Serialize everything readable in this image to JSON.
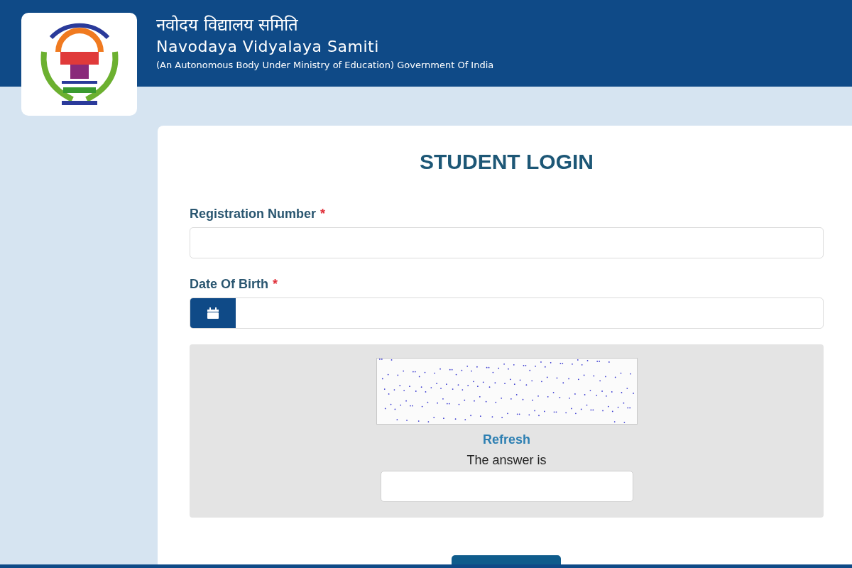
{
  "header": {
    "title_hindi": "नवोदय विद्यालय समिति",
    "title": "Navodaya Vidyalaya Samiti",
    "subtitle": "(An Autonomous Body Under Ministry of Education) Government Of India"
  },
  "form": {
    "title": "STUDENT LOGIN",
    "fields": [
      {
        "kind": "text",
        "label": "Registration Number",
        "required_mark": "*"
      },
      {
        "kind": "date",
        "label": "Date Of Birth",
        "required_mark": "*"
      }
    ],
    "captcha": {
      "refresh": "Refresh",
      "prompt": "The answer is"
    }
  }
}
